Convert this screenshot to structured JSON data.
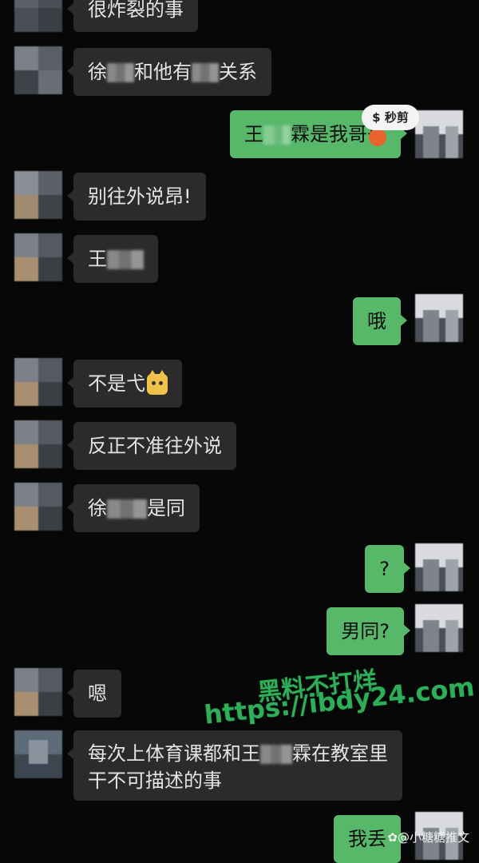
{
  "messages": [
    {
      "side": "in",
      "text_before": "很炸裂的事",
      "text_after": ""
    },
    {
      "side": "in",
      "text_before": "徐",
      "text_mid": "和他有",
      "text_after": "关系"
    },
    {
      "side": "out",
      "text_before": "王",
      "text_after": "霖是我哥哥"
    },
    {
      "side": "in",
      "text_before": "别往外说昂!",
      "text_after": ""
    },
    {
      "side": "in",
      "text_before": "王",
      "text_after": ""
    },
    {
      "side": "out",
      "text_before": "哦",
      "text_after": ""
    },
    {
      "side": "in",
      "text_before": "不是弋",
      "text_after": ""
    },
    {
      "side": "in",
      "text_before": "反正不准往外说",
      "text_after": ""
    },
    {
      "side": "in",
      "text_before": "徐",
      "text_after": "是同"
    },
    {
      "side": "out",
      "text_before": "?",
      "text_after": ""
    },
    {
      "side": "out",
      "text_before": "男同?",
      "text_after": ""
    },
    {
      "side": "in",
      "text_before": "嗯",
      "text_after": ""
    },
    {
      "side": "in",
      "line1_before": "每次上体育课都和王",
      "line1_after": "霖在教室里",
      "line2": "干不可描述的事"
    },
    {
      "side": "out",
      "text_before": "我丢",
      "text_after": ""
    }
  ],
  "badge": {
    "label": "秒剪"
  },
  "watermark": {
    "line1": "黑料不打烊",
    "line2": "https://ibdy24.com"
  },
  "source": {
    "label": "@小糖糖推文"
  },
  "colors": {
    "background": "#070707",
    "incoming_bubble": "#2b2b2b",
    "outgoing_bubble": "#57b86a",
    "watermark": "#2fae5a"
  }
}
